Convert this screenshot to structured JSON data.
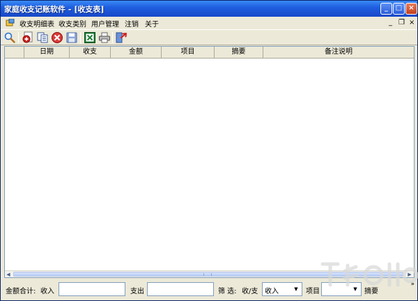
{
  "window": {
    "title": "家庭收支记账软件 - [收支表]",
    "title_buttons": {
      "minimize": "_",
      "maximize": "□",
      "close": "×"
    }
  },
  "menubar": {
    "items": [
      {
        "label": "收支明细表"
      },
      {
        "label": "收支类别"
      },
      {
        "label": "用户管理"
      },
      {
        "label": "注销"
      },
      {
        "label": "关于"
      }
    ],
    "mdi_controls": {
      "minimize": "_",
      "restore": "❐",
      "close": "×"
    }
  },
  "toolbar": {
    "icons": [
      "search-icon",
      "add-icon",
      "copy-icon",
      "delete-icon",
      "save-icon",
      "excel-export-icon",
      "print-icon",
      "exit-icon"
    ]
  },
  "grid": {
    "columns": [
      {
        "label": ""
      },
      {
        "label": "日期"
      },
      {
        "label": "收支"
      },
      {
        "label": "金额"
      },
      {
        "label": "项目"
      },
      {
        "label": "摘要"
      },
      {
        "label": "备注说明"
      }
    ],
    "rows": [],
    "scroll_left_arrow": "◀",
    "scroll_right_arrow": "▶"
  },
  "statusbar": {
    "total_label": "金额合计:",
    "income_label": "收入",
    "income_value": "",
    "expense_label": "支出",
    "expense_value": "",
    "filter_label": "筛 选:",
    "type_label": "收/支",
    "type_selected": "收入",
    "item_label": "项目",
    "item_selected": "",
    "summary_label": "摘要",
    "dropdown_arrow": "▼",
    "more_glyph": "»"
  },
  "colors": {
    "titlebar": "#1F5FE0",
    "chrome": "#ECE9D8",
    "border": "#7F9DB9"
  }
}
